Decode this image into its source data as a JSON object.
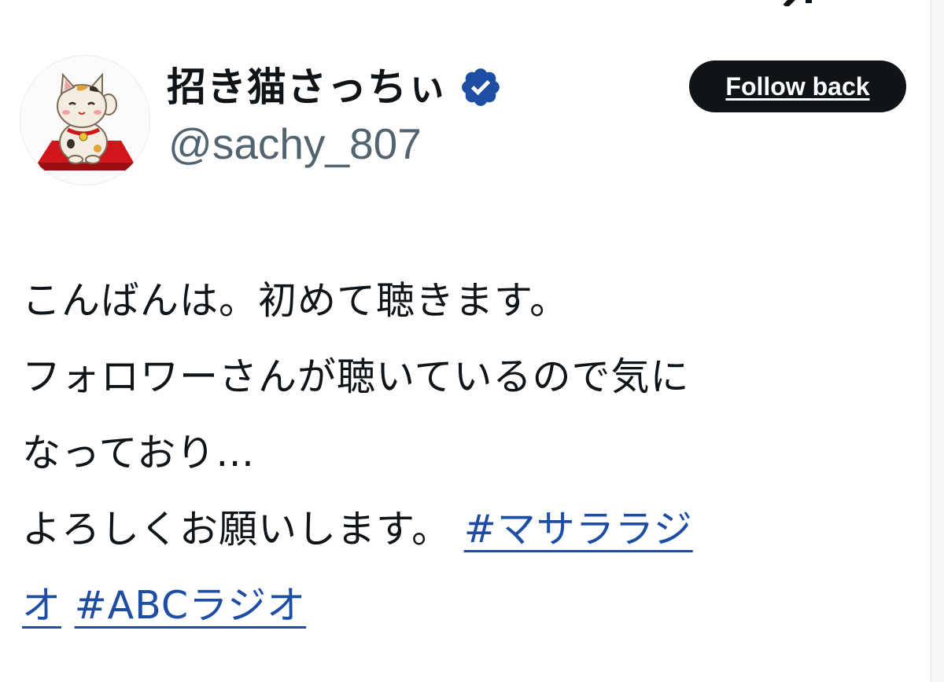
{
  "user": {
    "display_name": "招き猫さっちぃ",
    "handle": "@sachy_807",
    "verified": true,
    "avatar_icon": "maneki-neko-avatar"
  },
  "actions": {
    "follow_label": "Follow back"
  },
  "tweet": {
    "lines": [
      "こんばんは。初めて聴きます。",
      "フォロワーさんが聴いているので気に",
      "なっており…",
      "よろしくお願いします。"
    ],
    "hashtags": {
      "first_part1": "#マサララジ",
      "first_part2": "オ",
      "second": "#ABCラジオ"
    }
  },
  "colors": {
    "text": "#0f1419",
    "handle": "#536471",
    "link": "#1d4ea3",
    "verified": "#1d4ea3",
    "button_bg": "#0f1419",
    "button_text": "#ffffff"
  }
}
